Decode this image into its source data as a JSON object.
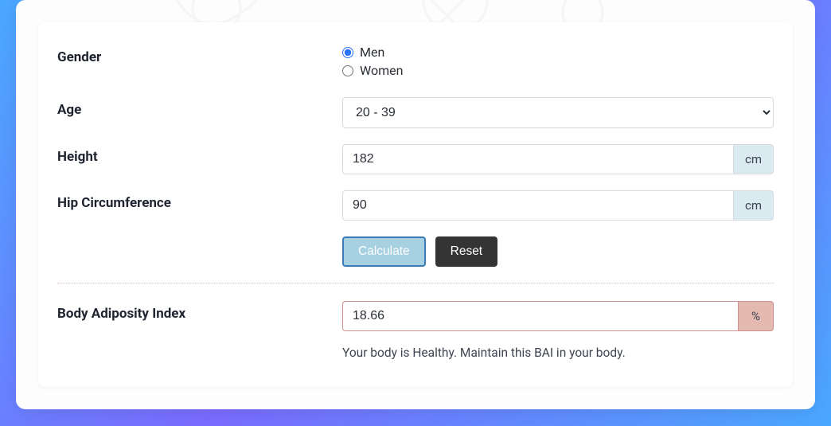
{
  "form": {
    "gender_label": "Gender",
    "gender_options": {
      "men": "Men",
      "women": "Women"
    },
    "gender_selected": "men",
    "age_label": "Age",
    "age_value": "20 - 39",
    "height_label": "Height",
    "height_value": "182",
    "height_unit": "cm",
    "hip_label": "Hip Circumference",
    "hip_value": "90",
    "hip_unit": "cm",
    "calculate_label": "Calculate",
    "reset_label": "Reset"
  },
  "result": {
    "label": "Body Adiposity Index",
    "value": "18.66",
    "unit": "%",
    "status": "Your body is Healthy. Maintain this BAI in your body."
  }
}
